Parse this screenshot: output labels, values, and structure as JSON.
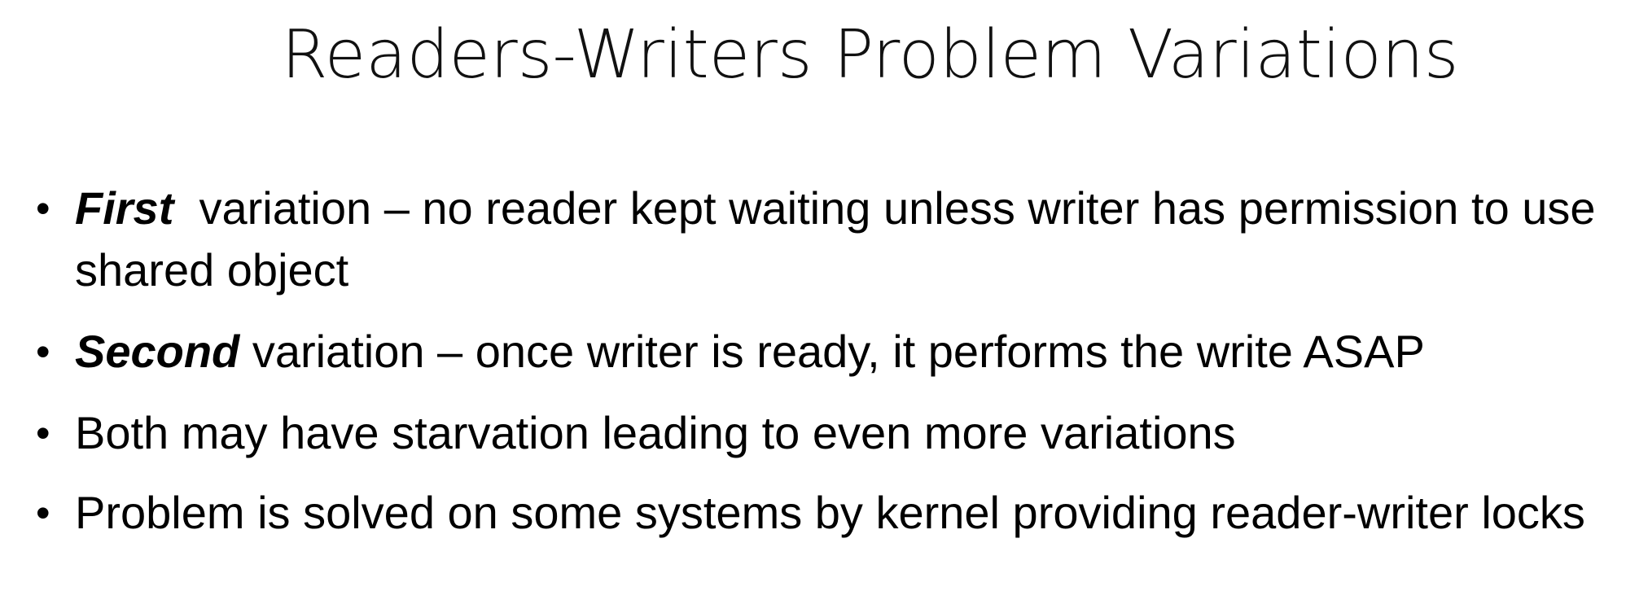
{
  "slide": {
    "title": "Readers-Writers Problem Variations",
    "bullets": [
      {
        "bullet_glyph": "•",
        "lead": "First",
        "text": "  variation – no reader kept waiting unless writer has permission to use shared object"
      },
      {
        "bullet_glyph": "•",
        "lead": "Second",
        "text": " variation – once writer is ready, it performs the write ASAP"
      },
      {
        "bullet_glyph": "•",
        "lead": "",
        "text": "Both may have starvation leading to even more variations"
      },
      {
        "bullet_glyph": "•",
        "lead": "",
        "text": "Problem is solved on some systems by kernel providing reader-writer locks"
      }
    ]
  }
}
